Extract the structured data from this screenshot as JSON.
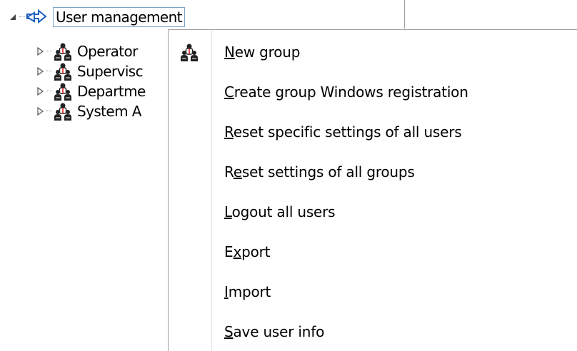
{
  "tree": {
    "root": {
      "label": "User management",
      "expander": "expanded-triangle",
      "icon": "user-management-arrows-icon"
    },
    "children": [
      {
        "label": "Operator",
        "expander": "collapsed-triangle",
        "icon": "user-group-icon"
      },
      {
        "label": "Supervisc",
        "expander": "collapsed-triangle",
        "icon": "user-group-icon"
      },
      {
        "label": "Departme",
        "expander": "collapsed-triangle",
        "icon": "user-group-icon"
      },
      {
        "label": "System A",
        "expander": "collapsed-triangle",
        "icon": "user-group-icon"
      }
    ]
  },
  "context_menu": {
    "items": [
      {
        "before": "",
        "access": "N",
        "after": "ew group",
        "icon": "user-group-icon"
      },
      {
        "before": "",
        "access": "C",
        "after": "reate group Windows registration",
        "icon": ""
      },
      {
        "before": "",
        "access": "R",
        "after": "eset specific settings of all users",
        "icon": ""
      },
      {
        "before": "R",
        "access": "e",
        "after": "set settings of all groups",
        "icon": ""
      },
      {
        "before": "",
        "access": "L",
        "after": "ogout all users",
        "icon": ""
      },
      {
        "before": "E",
        "access": "x",
        "after": "port",
        "icon": ""
      },
      {
        "before": "",
        "access": "I",
        "after": "mport",
        "icon": ""
      },
      {
        "before": "",
        "access": "S",
        "after": "ave user info",
        "icon": ""
      }
    ]
  },
  "colors": {
    "selection_border": "#7da2ce",
    "icon_blue": "#1f5fbf",
    "icon_dark": "#222222",
    "separator": "#a0a0a0"
  }
}
